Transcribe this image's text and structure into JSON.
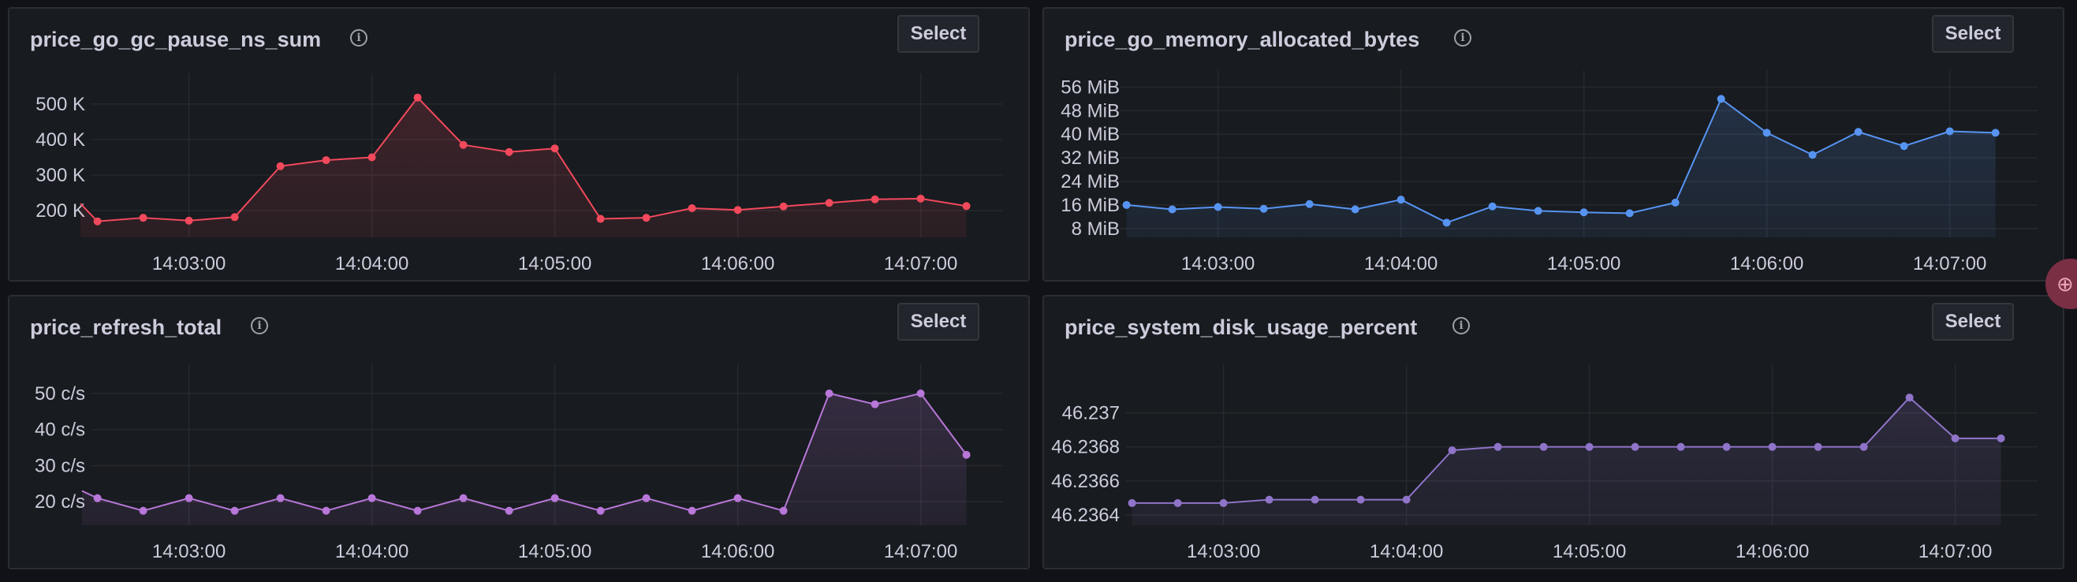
{
  "select_label": "Select",
  "info_glyph": "i",
  "side_badge_glyph": "⊕",
  "panels": [
    {
      "title": "price_go_gc_pause_ns_sum",
      "chart_data": {
        "type": "line",
        "title": "price_go_gc_pause_ns_sum",
        "color": "#f2495c",
        "x_ticks": [
          "14:03:00",
          "14:04:00",
          "14:05:00",
          "14:06:00",
          "14:07:00"
        ],
        "x_tick_minutes": [
          3,
          4,
          5,
          6,
          7
        ],
        "x_range_minutes": [
          2.45,
          7.45
        ],
        "y_ticks": [
          {
            "label": "200 K",
            "value": 200000
          },
          {
            "label": "300 K",
            "value": 300000
          },
          {
            "label": "400 K",
            "value": 400000
          },
          {
            "label": "500 K",
            "value": 500000
          }
        ],
        "ylim": [
          125000,
          555000
        ],
        "x_minutes": [
          2.5,
          2.75,
          3.0,
          3.25,
          3.5,
          3.75,
          4.0,
          4.25,
          4.5,
          4.75,
          5.0,
          5.25,
          5.5,
          5.75,
          6.0,
          6.25,
          6.5,
          6.75,
          7.0,
          7.25
        ],
        "values": [
          170000,
          180000,
          172000,
          182000,
          325000,
          342000,
          350000,
          518000,
          385000,
          365000,
          375000,
          177000,
          180000,
          207000,
          202000,
          212000,
          222000,
          232000,
          234000,
          213000
        ],
        "lead_value": 220000
      }
    },
    {
      "title": "price_go_memory_allocated_bytes",
      "chart_data": {
        "type": "line",
        "title": "price_go_memory_allocated_bytes",
        "color": "#5794f2",
        "x_ticks": [
          "14:03:00",
          "14:04:00",
          "14:05:00",
          "14:06:00",
          "14:07:00"
        ],
        "x_tick_minutes": [
          3,
          4,
          5,
          6,
          7
        ],
        "x_range_minutes": [
          2.48,
          7.48
        ],
        "y_ticks": [
          {
            "label": "8 MiB",
            "value": 8
          },
          {
            "label": "16 MiB",
            "value": 16
          },
          {
            "label": "24 MiB",
            "value": 24
          },
          {
            "label": "32 MiB",
            "value": 32
          },
          {
            "label": "40 MiB",
            "value": 40
          },
          {
            "label": "48 MiB",
            "value": 48
          },
          {
            "label": "56 MiB",
            "value": 56
          }
        ],
        "ylim": [
          5,
          58
        ],
        "unit": "MiB",
        "x_minutes": [
          2.5,
          2.75,
          3.0,
          3.25,
          3.5,
          3.75,
          4.0,
          4.25,
          4.5,
          4.75,
          5.0,
          5.25,
          5.5,
          5.75,
          6.0,
          6.25,
          6.5,
          6.75,
          7.0,
          7.25
        ],
        "values": [
          16,
          14.5,
          15.3,
          14.7,
          16.3,
          14.5,
          17.8,
          10,
          15.5,
          14,
          13.5,
          13.2,
          16.8,
          52,
          40.5,
          33,
          40.8,
          36,
          41,
          40.5
        ]
      }
    },
    {
      "title": "price_refresh_total",
      "chart_data": {
        "type": "line",
        "title": "price_refresh_total",
        "color": "#b877d9",
        "x_ticks": [
          "14:03:00",
          "14:04:00",
          "14:05:00",
          "14:06:00",
          "14:07:00"
        ],
        "x_tick_minutes": [
          3,
          4,
          5,
          6,
          7
        ],
        "x_range_minutes": [
          2.45,
          7.45
        ],
        "y_ticks": [
          {
            "label": "20 c/s",
            "value": 20
          },
          {
            "label": "30 c/s",
            "value": 30
          },
          {
            "label": "40 c/s",
            "value": 40
          },
          {
            "label": "50 c/s",
            "value": 50
          }
        ],
        "ylim": [
          13.5,
          55
        ],
        "unit": "c/s",
        "x_minutes": [
          2.5,
          2.75,
          3.0,
          3.25,
          3.5,
          3.75,
          4.0,
          4.25,
          4.5,
          4.75,
          5.0,
          5.25,
          5.5,
          5.75,
          6.0,
          6.25,
          6.5,
          6.75,
          7.0,
          7.25
        ],
        "values": [
          21,
          17.5,
          21,
          17.5,
          21,
          17.5,
          21,
          17.5,
          21,
          17.5,
          21,
          17.5,
          21,
          17.5,
          21,
          17.5,
          50,
          47,
          50,
          33
        ],
        "lead_value": 23
      }
    },
    {
      "title": "price_system_disk_usage_percent",
      "chart_data": {
        "type": "line",
        "title": "price_system_disk_usage_percent",
        "color": "#8f74c9",
        "x_ticks": [
          "14:03:00",
          "14:04:00",
          "14:05:00",
          "14:06:00",
          "14:07:00"
        ],
        "x_tick_minutes": [
          3,
          4,
          5,
          6,
          7
        ],
        "x_range_minutes": [
          2.45,
          7.45
        ],
        "y_ticks": [
          {
            "label": "46.2364",
            "value": 46.2364
          },
          {
            "label": "46.2366",
            "value": 46.2366
          },
          {
            "label": "46.2368",
            "value": 46.2368
          },
          {
            "label": "46.237",
            "value": 46.237
          }
        ],
        "ylim": [
          46.23634,
          46.23722
        ],
        "unit": "%",
        "x_minutes": [
          2.5,
          2.75,
          3.0,
          3.25,
          3.5,
          3.75,
          4.0,
          4.25,
          4.5,
          4.75,
          5.0,
          5.25,
          5.5,
          5.75,
          6.0,
          6.25,
          6.5,
          6.75,
          7.0,
          7.25
        ],
        "values": [
          46.23647,
          46.23647,
          46.23647,
          46.23649,
          46.23649,
          46.23649,
          46.23649,
          46.23678,
          46.2368,
          46.2368,
          46.2368,
          46.2368,
          46.2368,
          46.2368,
          46.2368,
          46.2368,
          46.2368,
          46.23709,
          46.23685,
          46.23685
        ]
      }
    }
  ]
}
